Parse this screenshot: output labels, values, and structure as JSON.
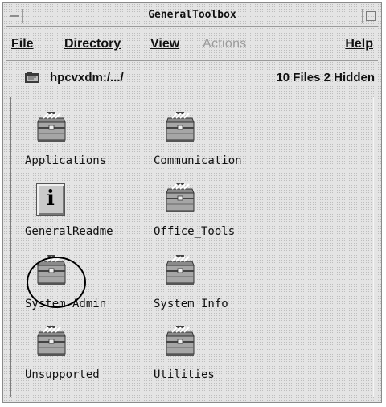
{
  "window": {
    "title": "GeneralToolbox"
  },
  "menu": {
    "file": "File",
    "directory": "Directory",
    "view": "View",
    "actions": "Actions",
    "help": "Help"
  },
  "pathbar": {
    "path": "hpcvxdm:/.../",
    "count": "10 Files 2 Hidden"
  },
  "items": [
    {
      "label": "Applications",
      "icon": "toolbox-icon"
    },
    {
      "label": "Communication",
      "icon": "toolbox-icon"
    },
    {
      "label": "GeneralReadme",
      "icon": "info-icon"
    },
    {
      "label": "Office_Tools",
      "icon": "toolbox-icon"
    },
    {
      "label": "System_Admin",
      "icon": "toolbox-icon",
      "circled": true
    },
    {
      "label": "System_Info",
      "icon": "toolbox-icon"
    },
    {
      "label": "Unsupported",
      "icon": "toolbox-icon"
    },
    {
      "label": "Utilities",
      "icon": "toolbox-icon"
    }
  ],
  "colors": {
    "background": "#e4e4e4",
    "text": "#111111",
    "disabled": "#9a9a9a"
  }
}
